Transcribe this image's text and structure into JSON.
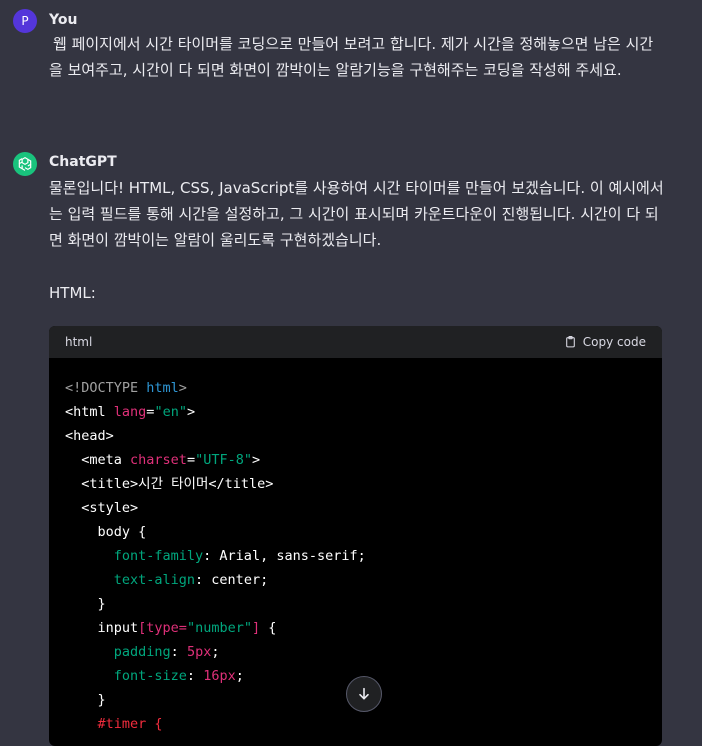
{
  "user_message": {
    "avatar_letter": "P",
    "author": "You",
    "text": "웹 페이지에서 시간 타이머를 코딩으로 만들어 보려고 합니다. 제가 시간을 정해놓으면 남은 시간을 보여주고, 시간이 다 되면 화면이 깜박이는 알람기능을 구현해주는 코딩을 작성해 주세요."
  },
  "assistant_message": {
    "author": "ChatGPT",
    "text": "물론입니다! HTML, CSS, JavaScript를 사용하여 시간 타이머를 만들어 보겠습니다. 이 예시에서는 입력 필드를 통해 시간을 설정하고, 그 시간이 표시되며 카운트다운이 진행됩니다. 시간이 다 되면 화면이 깜박이는 알람이 울리도록 구현하겠습니다.",
    "section_label": "HTML:"
  },
  "code_block": {
    "language": "html",
    "copy_label": "Copy code",
    "lines": [
      [
        {
          "t": "<!DOCTYPE ",
          "c": "t-gray"
        },
        {
          "t": "html",
          "c": "t-blue"
        },
        {
          "t": ">",
          "c": "t-gray"
        }
      ],
      [
        {
          "t": "<html ",
          "c": "t-tag"
        },
        {
          "t": "lang",
          "c": "t-attr"
        },
        {
          "t": "=",
          "c": "t-punct"
        },
        {
          "t": "\"en\"",
          "c": "t-str"
        },
        {
          "t": ">",
          "c": "t-tag"
        }
      ],
      [
        {
          "t": "<head>",
          "c": "t-tag"
        }
      ],
      [
        {
          "t": "  <meta ",
          "c": "t-tag"
        },
        {
          "t": "charset",
          "c": "t-attr"
        },
        {
          "t": "=",
          "c": "t-punct"
        },
        {
          "t": "\"UTF-8\"",
          "c": "t-str"
        },
        {
          "t": ">",
          "c": "t-tag"
        }
      ],
      [
        {
          "t": "  <title>",
          "c": "t-tag"
        },
        {
          "t": "시간 타이머",
          "c": "t-val"
        },
        {
          "t": "</title>",
          "c": "t-tag"
        }
      ],
      [
        {
          "t": "  <style>",
          "c": "t-tag"
        }
      ],
      [
        {
          "t": "    body {",
          "c": "t-val"
        }
      ],
      [
        {
          "t": "      font-family",
          "c": "t-str"
        },
        {
          "t": ": Arial, sans-serif;",
          "c": "t-val"
        }
      ],
      [
        {
          "t": "      text-align",
          "c": "t-str"
        },
        {
          "t": ": center;",
          "c": "t-val"
        }
      ],
      [
        {
          "t": "    }",
          "c": "t-val"
        }
      ],
      [
        {
          "t": "    input",
          "c": "t-val"
        },
        {
          "t": "[type=",
          "c": "t-attr"
        },
        {
          "t": "\"number\"",
          "c": "t-str"
        },
        {
          "t": "]",
          "c": "t-attr"
        },
        {
          "t": " {",
          "c": "t-val"
        }
      ],
      [
        {
          "t": "      padding",
          "c": "t-str"
        },
        {
          "t": ": ",
          "c": "t-val"
        },
        {
          "t": "5px",
          "c": "t-num"
        },
        {
          "t": ";",
          "c": "t-val"
        }
      ],
      [
        {
          "t": "      font-size",
          "c": "t-str"
        },
        {
          "t": ": ",
          "c": "t-val"
        },
        {
          "t": "16px",
          "c": "t-num"
        },
        {
          "t": ";",
          "c": "t-val"
        }
      ],
      [
        {
          "t": "    }",
          "c": "t-val"
        }
      ],
      [
        {
          "t": "    #timer {",
          "c": "t-sel"
        }
      ]
    ]
  }
}
